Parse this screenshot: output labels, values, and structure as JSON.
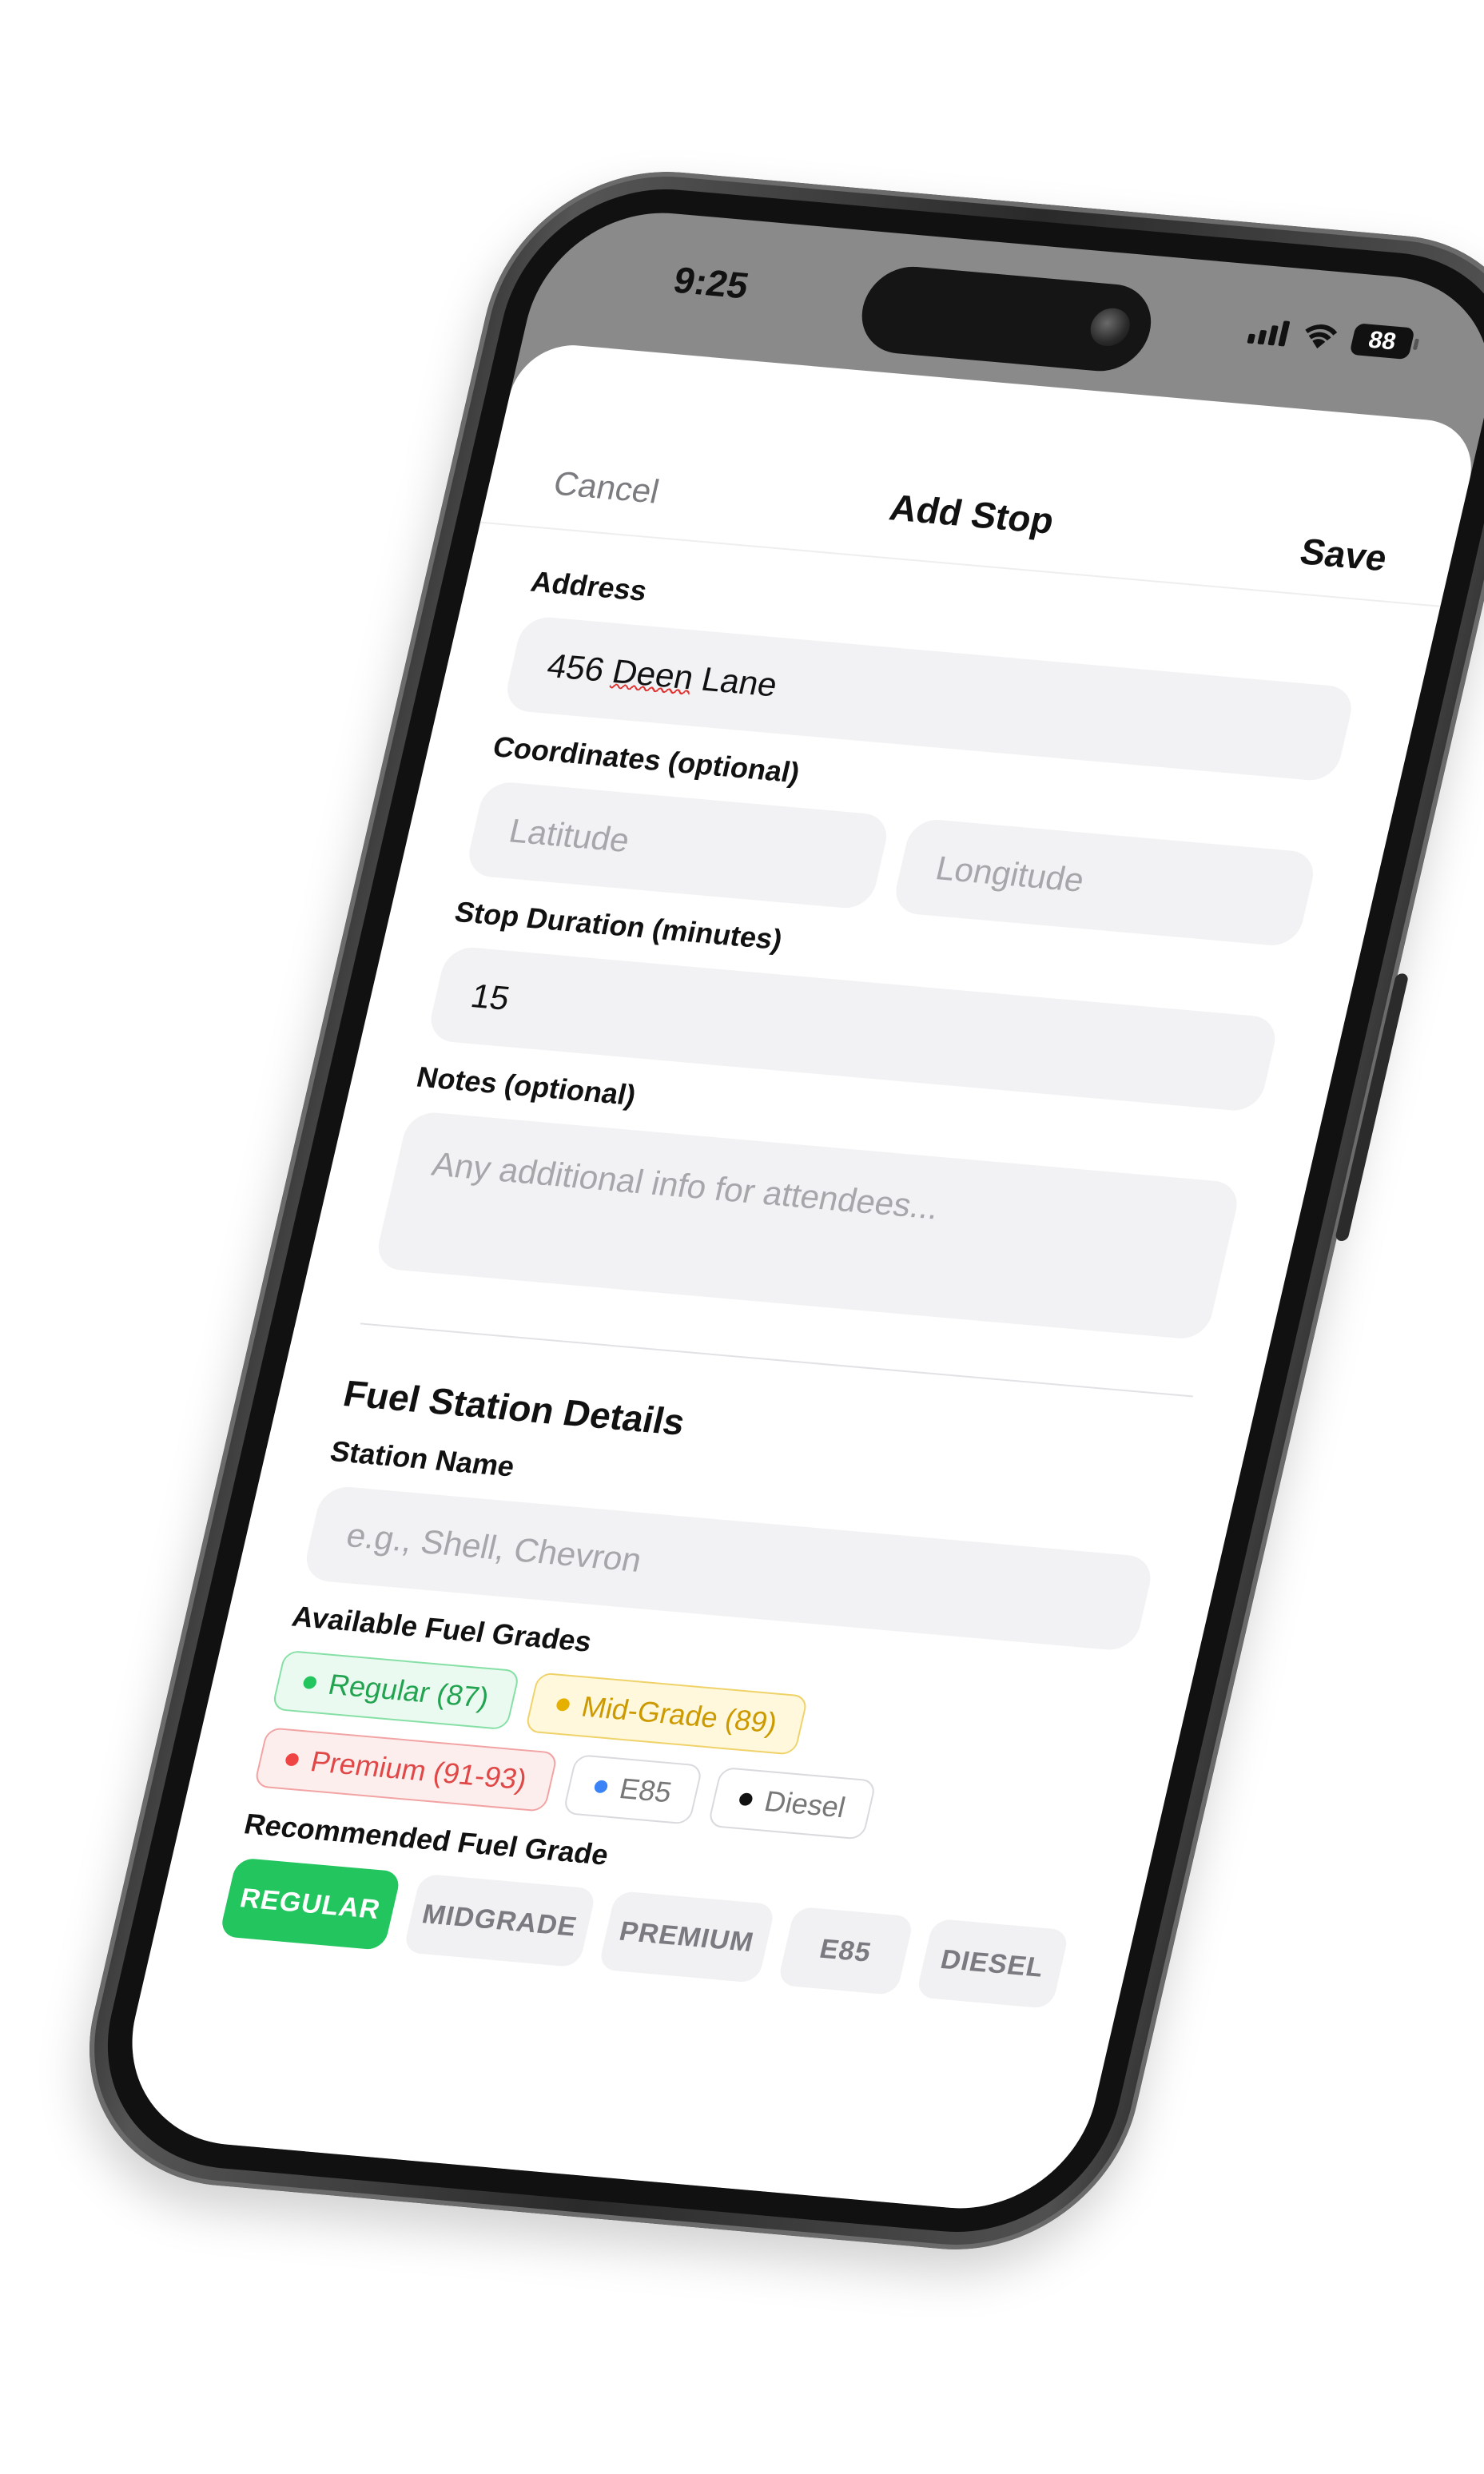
{
  "status_bar": {
    "time": "9:25",
    "battery": "88"
  },
  "nav": {
    "cancel_label": "Cancel",
    "title": "Add Stop",
    "save_label": "Save"
  },
  "form": {
    "address": {
      "label": "Address",
      "value_prefix": "456 ",
      "value_misspelled": "Deen",
      "value_suffix": " Lane"
    },
    "coordinates": {
      "label": "Coordinates (optional)",
      "latitude_placeholder": "Latitude",
      "longitude_placeholder": "Longitude"
    },
    "stop_duration": {
      "label": "Stop Duration (minutes)",
      "value": "15"
    },
    "notes": {
      "label": "Notes (optional)",
      "placeholder": "Any additional info for attendees..."
    }
  },
  "fuel": {
    "section_title": "Fuel Station Details",
    "station_name": {
      "label": "Station Name",
      "placeholder": "e.g., Shell, Chevron"
    },
    "available_grades": {
      "label": "Available Fuel Grades",
      "items": [
        {
          "label": "Regular (87)",
          "color": "#22c55e",
          "bg": "#eafaf0",
          "border": "#86e0a6",
          "text": "#22a350",
          "selected": true
        },
        {
          "label": "Mid-Grade (89)",
          "color": "#e6b000",
          "bg": "#fff8dc",
          "border": "#efd36a",
          "text": "#cc9a00",
          "selected": true
        },
        {
          "label": "Premium (91-93)",
          "color": "#ef4444",
          "bg": "#fdeeee",
          "border": "#f2a3a3",
          "text": "#e04848",
          "selected": true
        },
        {
          "label": "E85",
          "color": "#3b82f6",
          "bg": "#ffffff",
          "border": "#d9d9de",
          "text": "#777777",
          "selected": false
        },
        {
          "label": "Diesel",
          "color": "#111111",
          "bg": "#ffffff",
          "border": "#d9d9de",
          "text": "#777777",
          "selected": false
        }
      ]
    },
    "recommended": {
      "label": "Recommended Fuel Grade",
      "options": [
        "REGULAR",
        "MIDGRADE",
        "PREMIUM",
        "E85",
        "DIESEL"
      ],
      "selected": "REGULAR",
      "accent": "#22c55e"
    }
  }
}
